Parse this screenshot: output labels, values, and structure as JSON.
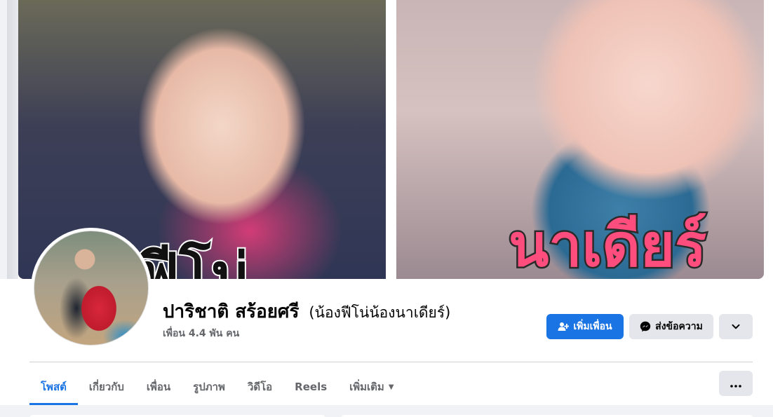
{
  "cover": {
    "left_caption": "ฟีโน่",
    "right_caption": "นาเดียร์"
  },
  "profile": {
    "name": "ปาริชาติ สร้อยศรี",
    "alternate_name": "(น้องฟีโน่น้องนาเดียร์)",
    "friends_count": "เพื่อน 4.4 พัน คน"
  },
  "actions": {
    "add_friend": "เพิ่มเพื่อน",
    "message": "ส่งข้อความ"
  },
  "tabs": [
    {
      "label": "โพสต์",
      "active": true
    },
    {
      "label": "เกี่ยวกับ"
    },
    {
      "label": "เพื่อน"
    },
    {
      "label": "รูปภาพ"
    },
    {
      "label": "วิดีโอ"
    },
    {
      "label": "Reels"
    },
    {
      "label": "เพิ่มเติม"
    }
  ],
  "icons": {
    "add_friend": "person-plus-icon",
    "message": "messenger-icon",
    "more": "chevron-down-icon",
    "tabs_more": "ellipsis-icon",
    "dropdown": "caret-down-icon"
  },
  "colors": {
    "accent": "#1b74e4",
    "secondary_button": "#e4e6eb",
    "muted_text": "#65676b"
  }
}
